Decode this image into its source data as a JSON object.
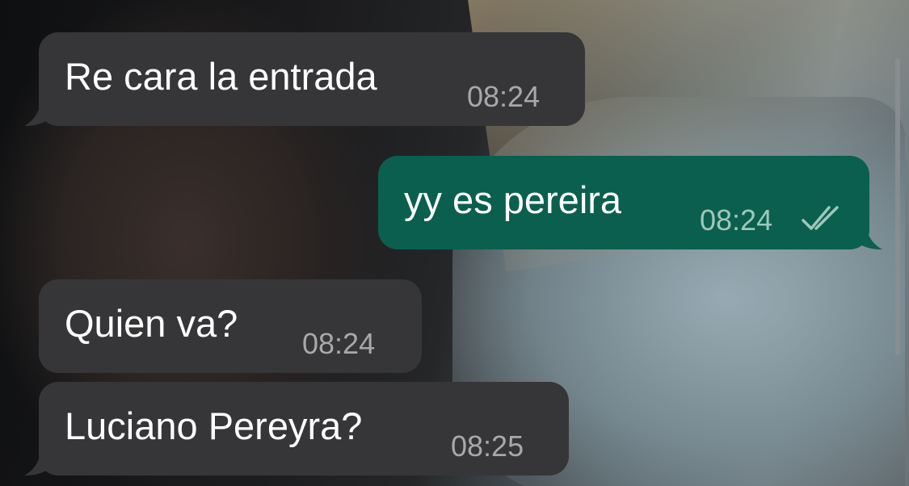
{
  "messages": [
    {
      "direction": "incoming",
      "text": "Re cara la entrada",
      "time": "08:24"
    },
    {
      "direction": "outgoing",
      "text": "yy es pereira",
      "time": "08:24",
      "status": "read-double-check"
    },
    {
      "direction": "incoming",
      "text": "Quien va?",
      "time": "08:24"
    },
    {
      "direction": "incoming",
      "text": "Luciano Pereyra?",
      "time": "08:25"
    }
  ],
  "colors": {
    "incoming_bubble": "#363638",
    "outgoing_bubble": "#0b5f4e",
    "timestamp_incoming": "#a8a8aa",
    "timestamp_outgoing": "#9ec7bc"
  }
}
